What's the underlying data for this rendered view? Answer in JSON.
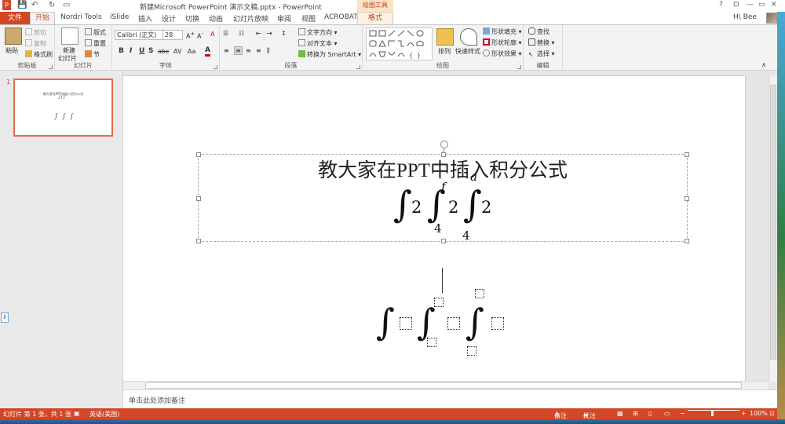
{
  "titlebar": {
    "doc_title": "新建Microsoft PowerPoint 演示文稿.pptx - PowerPoint",
    "tool_group": "绘图工具",
    "help": "?",
    "min": "—",
    "max": "▭",
    "close": "✕"
  },
  "tabs": {
    "file": "文件",
    "home": "开始",
    "nordri": "Nordri Tools",
    "islide": "iSlide",
    "insert": "插入",
    "design": "设计",
    "transitions": "切换",
    "animations": "动画",
    "slideshow": "幻灯片放映",
    "review": "审阅",
    "view": "视图",
    "acrobat": "ACROBAT",
    "format": "格式",
    "user": "H\\ Bee"
  },
  "ribbon": {
    "clipboard": {
      "label": "剪贴板",
      "paste": "粘贴",
      "cut": "剪切",
      "copy": "复制",
      "format_painter": "格式刷"
    },
    "slides": {
      "label": "幻灯片",
      "new_slide": "新建",
      "new_slide2": "幻灯片",
      "layout": "版式",
      "reset": "重置",
      "section": "节"
    },
    "font": {
      "label": "字体",
      "font_name": "Calibri (正文)",
      "font_size": "28",
      "bold": "B",
      "italic": "I",
      "underline": "U",
      "strike": "S",
      "abc": "abc",
      "spacing": "AV",
      "case": "Aa",
      "color": "A"
    },
    "paragraph": {
      "label": "段落",
      "text_direction": "文字方向",
      "align_text": "对齐文本",
      "smartart": "转换为 SmartArt"
    },
    "drawing": {
      "label": "绘图",
      "arrange": "排列",
      "quick_styles": "快速样式",
      "shape_fill": "形状填充",
      "shape_outline": "形状轮廓",
      "shape_effects": "形状效果"
    },
    "editing": {
      "label": "编辑",
      "find": "查找",
      "replace": "替换",
      "select": "选择"
    }
  },
  "thumbnail": {
    "number": "1",
    "title": "教大家在PPT中插入积分公式"
  },
  "slide": {
    "title": "教大家在PPT中插入积分公式",
    "formula1": {
      "integral": "∫",
      "c1": "2",
      "upper2": "f",
      "lower2": "4",
      "c2": "2",
      "upper3": "a",
      "lower3": "4",
      "c3": "2"
    },
    "formula2": {
      "integral": "∫"
    }
  },
  "notes": {
    "placeholder": "单击此处添加备注"
  },
  "statusbar": {
    "slide_info": "幻灯片 第 1 张，共 1 张",
    "language": "英语(美国)",
    "notes": "备注",
    "comments": "批注",
    "zoom_minus": "−",
    "zoom_plus": "+",
    "zoom": "100%"
  },
  "colors": {
    "accent": "#d24726",
    "selection": "#e86b4a"
  }
}
